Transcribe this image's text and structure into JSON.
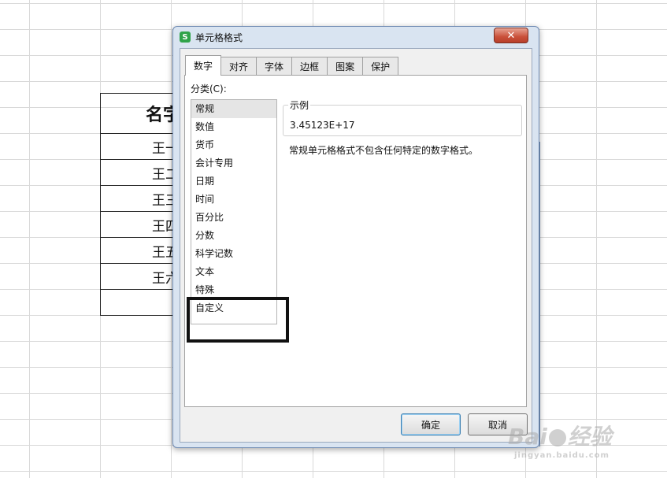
{
  "sheet": {
    "header_cell": "名字",
    "rows": [
      "王一",
      "王二",
      "王三",
      "王四",
      "王五",
      "王六",
      ""
    ]
  },
  "dialog": {
    "title": "单元格格式",
    "app_icon_glyph": "S",
    "close_glyph": "✕",
    "tabs": [
      {
        "label": "数字"
      },
      {
        "label": "对齐"
      },
      {
        "label": "字体"
      },
      {
        "label": "边框"
      },
      {
        "label": "图案"
      },
      {
        "label": "保护"
      }
    ],
    "active_tab": "数字",
    "category_label": "分类(C):",
    "categories": [
      {
        "label": "常规"
      },
      {
        "label": "数值"
      },
      {
        "label": "货币"
      },
      {
        "label": "会计专用"
      },
      {
        "label": "日期"
      },
      {
        "label": "时间"
      },
      {
        "label": "百分比"
      },
      {
        "label": "分数"
      },
      {
        "label": "科学记数"
      },
      {
        "label": "文本"
      },
      {
        "label": "特殊"
      },
      {
        "label": "自定义"
      }
    ],
    "selected_category": "常规",
    "sample_label": "示例",
    "sample_value": "3.45123E+17",
    "description": "常规单元格格式不包含任何特定的数字格式。",
    "ok_label": "确定",
    "cancel_label": "取消"
  },
  "watermark": {
    "brand_left": "Bai",
    "brand_right": "经验",
    "url": "jingyan.baidu.com"
  },
  "colors": {
    "frame": "#d9e4f1",
    "close": "#c9503a",
    "highlight": "#111111"
  }
}
